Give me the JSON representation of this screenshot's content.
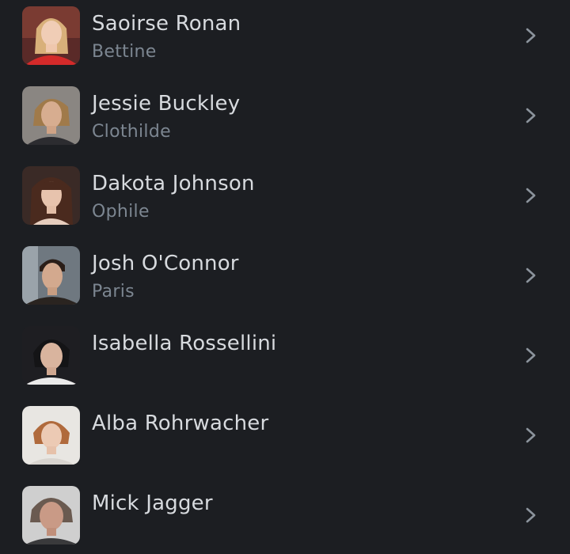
{
  "cast": [
    {
      "name": "Saoirse Ronan",
      "role": "Bettine",
      "avatar_icon": "portrait-saoirse-ronan"
    },
    {
      "name": "Jessie Buckley",
      "role": "Clothilde",
      "avatar_icon": "portrait-jessie-buckley"
    },
    {
      "name": "Dakota Johnson",
      "role": "Ophile",
      "avatar_icon": "portrait-dakota-johnson"
    },
    {
      "name": "Josh O'Connor",
      "role": "Paris",
      "avatar_icon": "portrait-josh-oconnor"
    },
    {
      "name": "Isabella Rossellini",
      "role": "",
      "avatar_icon": "portrait-isabella-rossellini"
    },
    {
      "name": "Alba Rohrwacher",
      "role": "",
      "avatar_icon": "portrait-alba-rohrwacher"
    },
    {
      "name": "Mick Jagger",
      "role": "",
      "avatar_icon": "portrait-mick-jagger"
    }
  ],
  "chevron_icon": "chevron-right-icon",
  "colors": {
    "background": "#1c1e22",
    "name_text": "#d7dade",
    "role_text": "#7c8691",
    "chevron": "#8b939c"
  }
}
